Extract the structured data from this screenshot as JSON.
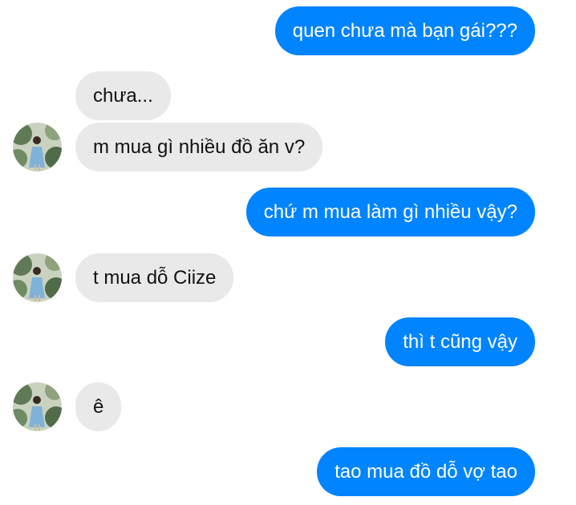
{
  "conversation": {
    "messages": [
      {
        "sender": "me",
        "text": "quen chưa mà bạn gái???"
      },
      {
        "sender": "them",
        "text": "chưa..."
      },
      {
        "sender": "them",
        "text": "m mua gì nhiều đồ ăn v?"
      },
      {
        "sender": "me",
        "text": "chứ m mua làm gì nhiều vậy?"
      },
      {
        "sender": "them",
        "text": "t mua dỗ Ciize"
      },
      {
        "sender": "me",
        "text": "thì t cũng vậy"
      },
      {
        "sender": "them",
        "text": "ê"
      },
      {
        "sender": "me",
        "text": "tao mua đồ dỗ vợ tao"
      }
    ]
  },
  "colors": {
    "outgoing_bubble": "#0084ff",
    "incoming_bubble": "#e9e9e9"
  },
  "icons": {
    "avatar": "contact-avatar-photo"
  }
}
